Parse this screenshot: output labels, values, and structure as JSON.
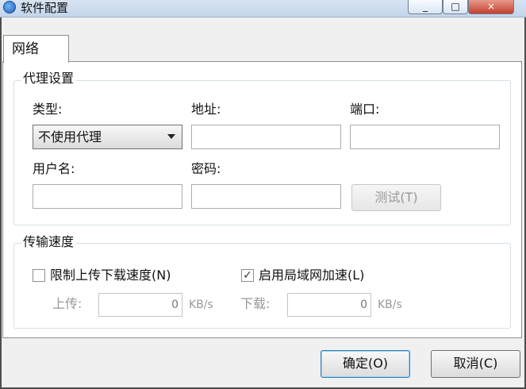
{
  "window": {
    "title": "软件配置",
    "controls": {
      "minimize": "_",
      "maximize": "□",
      "close": "×"
    }
  },
  "tabs": [
    {
      "label": "网络",
      "selected": true
    }
  ],
  "proxy": {
    "group_title": "代理设置",
    "type_label": "类型:",
    "type_value": "不使用代理",
    "address_label": "地址:",
    "address_value": "",
    "port_label": "端口:",
    "port_value": "",
    "username_label": "用户名:",
    "username_value": "",
    "password_label": "密码:",
    "password_value": "",
    "test_button": "测试(T)"
  },
  "speed": {
    "group_title": "传输速度",
    "limit_speed": {
      "label": "限制上传下载速度(N)",
      "checked": false
    },
    "lan_accel": {
      "label": "启用局域网加速(L)",
      "checked": true
    },
    "upload_label": "上传:",
    "upload_value": "0",
    "upload_unit": "KB/s",
    "download_label": "下载:",
    "download_value": "0",
    "download_unit": "KB/s"
  },
  "footer": {
    "ok": "确定(O)",
    "cancel": "取消(C)"
  },
  "icons": {
    "app": "app-icon",
    "dropdown": "chevron-down-icon",
    "check": "checkmark-icon"
  },
  "colors": {
    "titlebar": "#c3d5ea",
    "window_bg": "#f0f0f0",
    "panel_bg": "#ffffff",
    "border": "#8e8f8f",
    "disabled_text": "#999999"
  }
}
